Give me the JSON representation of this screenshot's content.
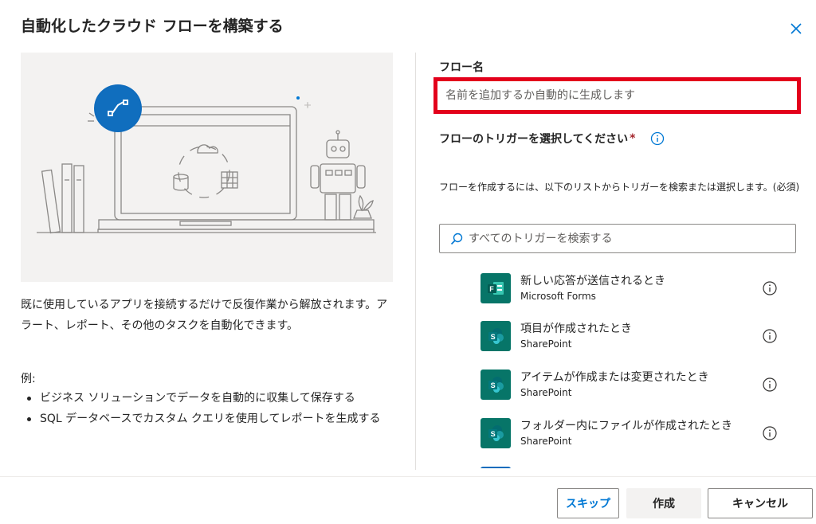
{
  "dialog": {
    "title": "自動化したクラウド フローを構築する",
    "close_icon": "close-icon"
  },
  "left": {
    "description": "既に使用しているアプリを接続するだけで反復作業から解放されます。アラート、レポート、その他のタスクを自動化できます。",
    "examples_label": "例:",
    "examples": [
      "ビジネス ソリューションでデータを自動的に収集して保存する",
      "SQL データベースでカスタム クエリを使用してレポートを生成する"
    ]
  },
  "form": {
    "flow_name_label": "フロー名",
    "flow_name_placeholder": "名前を追加するか自動的に生成します",
    "flow_name_value": "",
    "trigger_label": "フローのトリガーを選択してください",
    "required_marker": "*",
    "trigger_help": "フローを作成するには、以下のリストからトリガーを検索または選択します。(必須)",
    "search_placeholder": "すべてのトリガーを検索する"
  },
  "triggers": [
    {
      "title": "新しい応答が送信されるとき",
      "app": "Microsoft Forms",
      "icon": "forms-icon"
    },
    {
      "title": "項目が作成されたとき",
      "app": "SharePoint",
      "icon": "sharepoint-icon"
    },
    {
      "title": "アイテムが作成または変更されたとき",
      "app": "SharePoint",
      "icon": "sharepoint-icon"
    },
    {
      "title": "フォルダー内にファイルが作成されたとき",
      "app": "SharePoint",
      "icon": "sharepoint-icon"
    }
  ],
  "footer": {
    "skip_label": "スキップ",
    "create_label": "作成",
    "cancel_label": "キャンセル"
  },
  "colors": {
    "accent": "#0078d4",
    "highlight_border": "#e3001b",
    "sharepoint_teal": "#077568",
    "required": "#a4262c"
  }
}
